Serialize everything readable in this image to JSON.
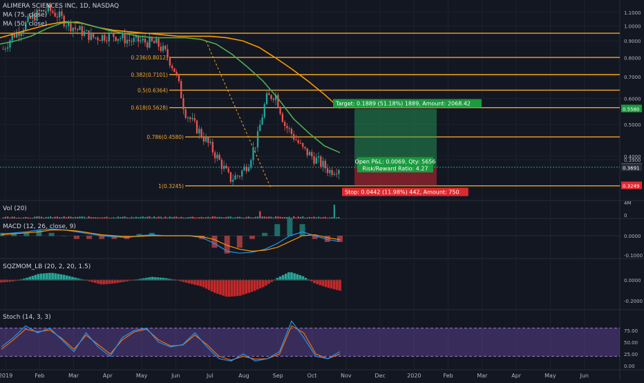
{
  "chart_data": {
    "type": "candlestick",
    "symbol": "ALIMERA SCIENCES INC, 1D, NASDAQ",
    "ma_labels": [
      "MA (75, close)",
      "MA (50, close)"
    ],
    "price_axis": {
      "min": 0.3,
      "max": 1.2,
      "scale": "log",
      "ticks": [
        "1.1000",
        "1.0000",
        "0.9000",
        "0.8000",
        "0.7000",
        "0.6000",
        "0.5000",
        "0.4000",
        "0.3900"
      ],
      "top_tick": "1.1000"
    },
    "x_axis_labels": [
      "2019",
      "Feb",
      "Mar",
      "Apr",
      "May",
      "Jun",
      "Jul",
      "Aug",
      "Sep",
      "Oct",
      "Nov",
      "Dec",
      "2020",
      "Feb",
      "Mar",
      "Apr",
      "May",
      "Jun"
    ],
    "price_path": [
      0.85,
      0.93,
      0.98,
      1.05,
      1.1,
      1.12,
      1.08,
      1.02,
      0.98,
      0.95,
      0.92,
      0.93,
      0.94,
      0.92,
      0.9,
      0.9,
      0.89,
      0.88,
      0.82,
      0.72,
      0.55,
      0.5,
      0.46,
      0.42,
      0.38,
      0.34,
      0.35,
      0.38,
      0.45,
      0.6,
      0.62,
      0.5,
      0.46,
      0.42,
      0.4,
      0.38,
      0.36,
      0.37
    ],
    "ma75_path": [
      0.92,
      0.95,
      0.98,
      1.01,
      1.03,
      1.02,
      0.99,
      0.97,
      0.96,
      0.95,
      0.94,
      0.93,
      0.93,
      0.93,
      0.92,
      0.9,
      0.86,
      0.8,
      0.74,
      0.68,
      0.62,
      0.56
    ],
    "ma50_path": [
      0.88,
      0.9,
      0.93,
      0.98,
      1.02,
      1.03,
      1.0,
      0.97,
      0.95,
      0.93,
      0.92,
      0.92,
      0.92,
      0.91,
      0.88,
      0.82,
      0.75,
      0.68,
      0.6,
      0.52,
      0.47,
      0.43,
      0.41
    ],
    "fib_levels": [
      {
        "label": "0.236(0.8012)",
        "value": 0.8012
      },
      {
        "label": "0.382(0.7101)",
        "value": 0.7101
      },
      {
        "label": "0.5(0.6364)",
        "value": 0.6364
      },
      {
        "label": "0.618(0.5628)",
        "value": 0.5628
      },
      {
        "label": "0.786(0.4580)",
        "value": 0.458
      },
      {
        "label": "1(0.3245)",
        "value": 0.3245
      }
    ],
    "fib_top_value": 0.95,
    "current_price": 0.37,
    "price_tags": [
      {
        "text": "0.5580",
        "value": 0.558,
        "kind": "target"
      },
      {
        "text": "0.3700",
        "value": 0.37,
        "kind": "current"
      },
      {
        "text": "0.3691",
        "value": 0.3691,
        "kind": "dark"
      },
      {
        "text": "0.3249",
        "value": 0.3249,
        "kind": "stop"
      }
    ],
    "position": {
      "target_text": "Target: 0.1889 (51.18%) 1889, Amount: 2068.42",
      "open_text": "Open P&L: 0.0069, Qty: 5656",
      "rr_text": "Risk/Reward Ratio: 4.27",
      "stop_text": "Stop: 0.0442 (11.98%) 442, Amount: 750",
      "entry": 0.3691,
      "target": 0.558,
      "stop": 0.3249
    },
    "volume": {
      "label": "Vol (20)",
      "axis_label": "4M",
      "zero": "0"
    },
    "macd": {
      "label": "MACD (12, 26, close, 9)",
      "ticks": [
        "0.0000",
        "-0.1000"
      ],
      "line": [
        0.01,
        0.015,
        0.02,
        0.03,
        0.035,
        0.03,
        0.02,
        0.01,
        0.0,
        -0.005,
        -0.01,
        0.0,
        0.005,
        0.0,
        0.0,
        0.0,
        -0.01,
        -0.04,
        -0.08,
        -0.09,
        -0.085,
        -0.07,
        -0.04,
        0.0,
        0.02,
        0.0,
        -0.02,
        -0.03
      ],
      "signal": [
        0.005,
        0.01,
        0.015,
        0.02,
        0.03,
        0.03,
        0.025,
        0.015,
        0.005,
        0.0,
        -0.005,
        -0.003,
        0.0,
        0.0,
        0.0,
        0.0,
        -0.005,
        -0.02,
        -0.05,
        -0.07,
        -0.08,
        -0.075,
        -0.06,
        -0.03,
        0.0,
        0.005,
        -0.01,
        -0.02
      ]
    },
    "sqzmom": {
      "label": "SQZMOM_LB (20, 2, 20, 1.5)",
      "ticks": [
        "0.0000",
        "-0.2000"
      ],
      "hist": [
        -0.02,
        -0.01,
        0.02,
        0.06,
        0.07,
        0.05,
        0.02,
        -0.01,
        -0.04,
        -0.03,
        -0.01,
        0.01,
        0.03,
        0.02,
        0.0,
        -0.03,
        -0.06,
        -0.12,
        -0.16,
        -0.15,
        -0.11,
        -0.06,
        0.02,
        0.08,
        0.04,
        -0.03,
        -0.07,
        -0.1
      ]
    },
    "stoch": {
      "label": "Stoch (14, 3, 3)",
      "ticks": [
        "75.00",
        "50.00",
        "25.00",
        "0.00"
      ],
      "bands": [
        80,
        20
      ],
      "k": [
        40,
        60,
        85,
        70,
        80,
        55,
        30,
        70,
        40,
        20,
        60,
        75,
        80,
        50,
        40,
        45,
        70,
        40,
        15,
        10,
        25,
        10,
        15,
        30,
        95,
        60,
        20,
        15,
        30
      ],
      "d": [
        35,
        55,
        78,
        72,
        76,
        58,
        35,
        65,
        45,
        25,
        55,
        72,
        78,
        55,
        42,
        44,
        65,
        45,
        20,
        12,
        20,
        14,
        15,
        25,
        85,
        70,
        25,
        15,
        25
      ]
    }
  }
}
